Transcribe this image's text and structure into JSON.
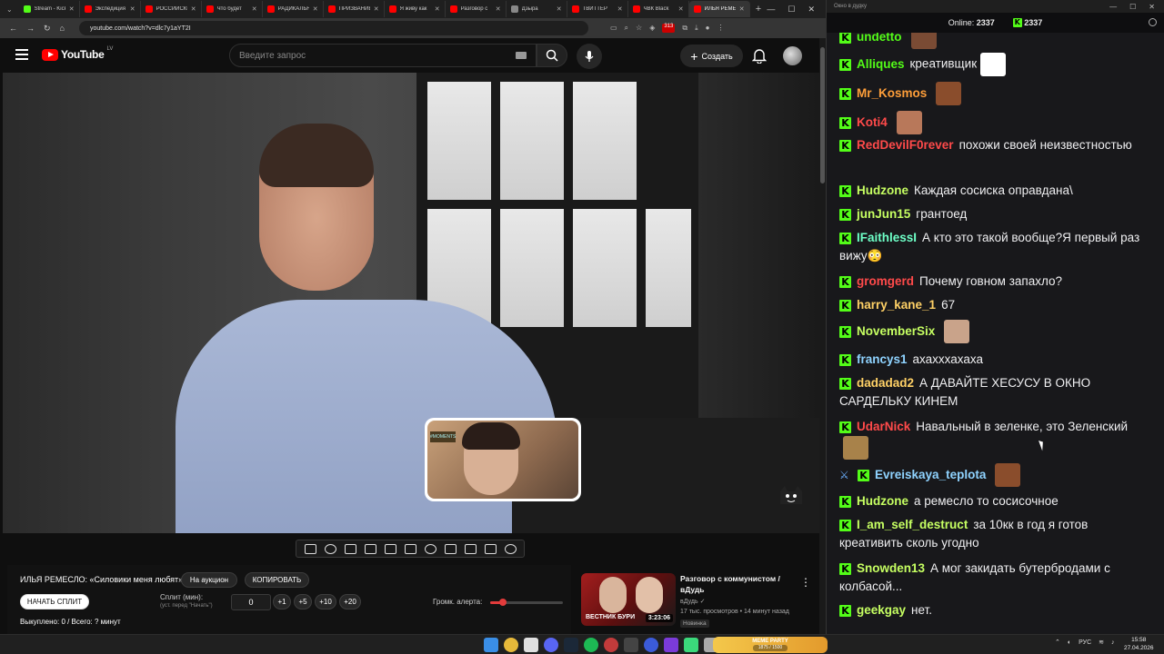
{
  "browser": {
    "tabs": [
      {
        "title": "Stream - Kick",
        "color": "#53fc18",
        "active": false
      },
      {
        "title": "Экспедиция",
        "color": "#ff0000",
        "active": false
      },
      {
        "title": "РОССИЙСКИЙ",
        "color": "#ff0000",
        "active": false
      },
      {
        "title": "Что будет",
        "color": "#ff0000",
        "active": false
      },
      {
        "title": "РАДИКАЛЬНЫЙ",
        "color": "#ff0000",
        "active": false
      },
      {
        "title": "ПРИЗВАНИЕ",
        "color": "#ff0000",
        "active": false
      },
      {
        "title": "Я живу как",
        "color": "#ff0000",
        "active": false
      },
      {
        "title": "Разговор с",
        "color": "#ff0000",
        "active": false
      },
      {
        "title": "Дзыра",
        "color": "#888888",
        "active": false
      },
      {
        "title": "ТВИТТЕР",
        "color": "#ff0000",
        "active": false
      },
      {
        "title": "ЧВК Black",
        "color": "#ff0000",
        "active": false
      },
      {
        "title": "ИЛЬЯ РЕМЕСЛО",
        "color": "#ff0000",
        "active": true
      }
    ],
    "url": "youtube.com/watch?v=dlc7y1aYT2I",
    "ext_badge": "313"
  },
  "youtube": {
    "logo_text": "YouTube",
    "country_code": "LV",
    "search_placeholder": "Введите запрос",
    "create_label": "Создать",
    "webcam_sticker": "#MOMENTS"
  },
  "auction": {
    "title": "ИЛЬЯ РЕМЕСЛО: «Силовики меня любят»",
    "on_auction_label": "На аукцион",
    "copy_label": "КОПИРОВАТЬ",
    "start_split_label": "НАЧАТЬ СПЛИТ",
    "split_label": "Сплит (мин):",
    "split_sub": "(уст. перед \"Начать\")",
    "split_value": "0",
    "increments": [
      "+1",
      "+5",
      "+10",
      "+20"
    ],
    "volume_label": "Громк. алерта:",
    "volume_level": 0.18,
    "bought_text": "Выкуплено: 0 / Всего: ? минут"
  },
  "recommendation": {
    "title": "Разговор с коммунистом / вДудь",
    "channel": "вДудь",
    "meta": "17 тыс. просмотров • 14 минут назад",
    "badge": "Новинка",
    "thumb_caption": "ВЕСТНИК БУРИ",
    "duration": "3:23:06"
  },
  "chat": {
    "window_title": "Окно в дудку",
    "online_label": "Online:",
    "online_count": "2337",
    "kick_count": "2337",
    "messages": [
      {
        "user": "undetto",
        "color": "#53fc18",
        "text": "",
        "emote": "#7a4b34"
      },
      {
        "user": "Alliques",
        "color": "#53fc18",
        "text": "креативщик",
        "emote": "#ffffff"
      },
      {
        "user": "Mr_Kosmos",
        "color": "#ff9f3a",
        "text": "",
        "emote": "#8a4d2c"
      },
      {
        "user": "Koti4",
        "color": "#ff4a4a",
        "text": "",
        "emote": "#b8785a"
      },
      {
        "user": "RedDevilF0rever",
        "color": "#ff4a4a",
        "text": "похожи своей неизвестностью",
        "emote": ""
      },
      {
        "user": "Hudzone",
        "color": "#c6ff62",
        "text": "Каждая сосиска оправдана\\",
        "emote": ""
      },
      {
        "user": "junJun15",
        "color": "#c6ff62",
        "text": "грантоед",
        "emote": ""
      },
      {
        "user": "IFaithlessI",
        "color": "#6effc7",
        "text": "А кто это такой вообще?Я первый раз вижу😳",
        "emote": ""
      },
      {
        "user": "gromgerd",
        "color": "#ff4a4a",
        "text": "Почему говном запахло?",
        "emote": ""
      },
      {
        "user": "harry_kane_1",
        "color": "#ffd166",
        "text": "67",
        "emote": ""
      },
      {
        "user": "NovemberSix",
        "color": "#c6ff62",
        "text": "",
        "emote": "#c9a38a"
      },
      {
        "user": "francys1",
        "color": "#8fd3ff",
        "text": "ахахххахаха",
        "emote": ""
      },
      {
        "user": "dadadad2",
        "color": "#ffd166",
        "text": "А ДАВАЙТЕ ХЕСУСУ В ОКНО САРДЕЛЬКУ КИНЕМ",
        "emote": ""
      },
      {
        "user": "UdarNick",
        "color": "#ff4a4a",
        "text": "Навальный в зеленке, это Зеленский",
        "emote": "#a8824a"
      },
      {
        "user": "Evreiskaya_teplota",
        "color": "#8fd3ff",
        "text": "",
        "emote": "#8a4d2c",
        "sword": true
      },
      {
        "user": "Hudzone",
        "color": "#c6ff62",
        "text": "а ремесло то сосисочное",
        "emote": ""
      },
      {
        "user": "I_am_self_destruct",
        "color": "#c6ff62",
        "text": "за 10кк в год я готов креативить сколь угодно",
        "emote": ""
      },
      {
        "user": "Snowden13",
        "color": "#c6ff62",
        "text": "А мог закидать бутербродами с колбасой...",
        "emote": ""
      },
      {
        "user": "geekgay",
        "color": "#c6ff62",
        "text": "нет.",
        "emote": ""
      }
    ]
  },
  "taskbar": {
    "meme_title": "MEME PARTY",
    "meme_progress": "1875 / 1500",
    "lang": "РУС",
    "time": "15:58",
    "date": "27.04.2026"
  }
}
